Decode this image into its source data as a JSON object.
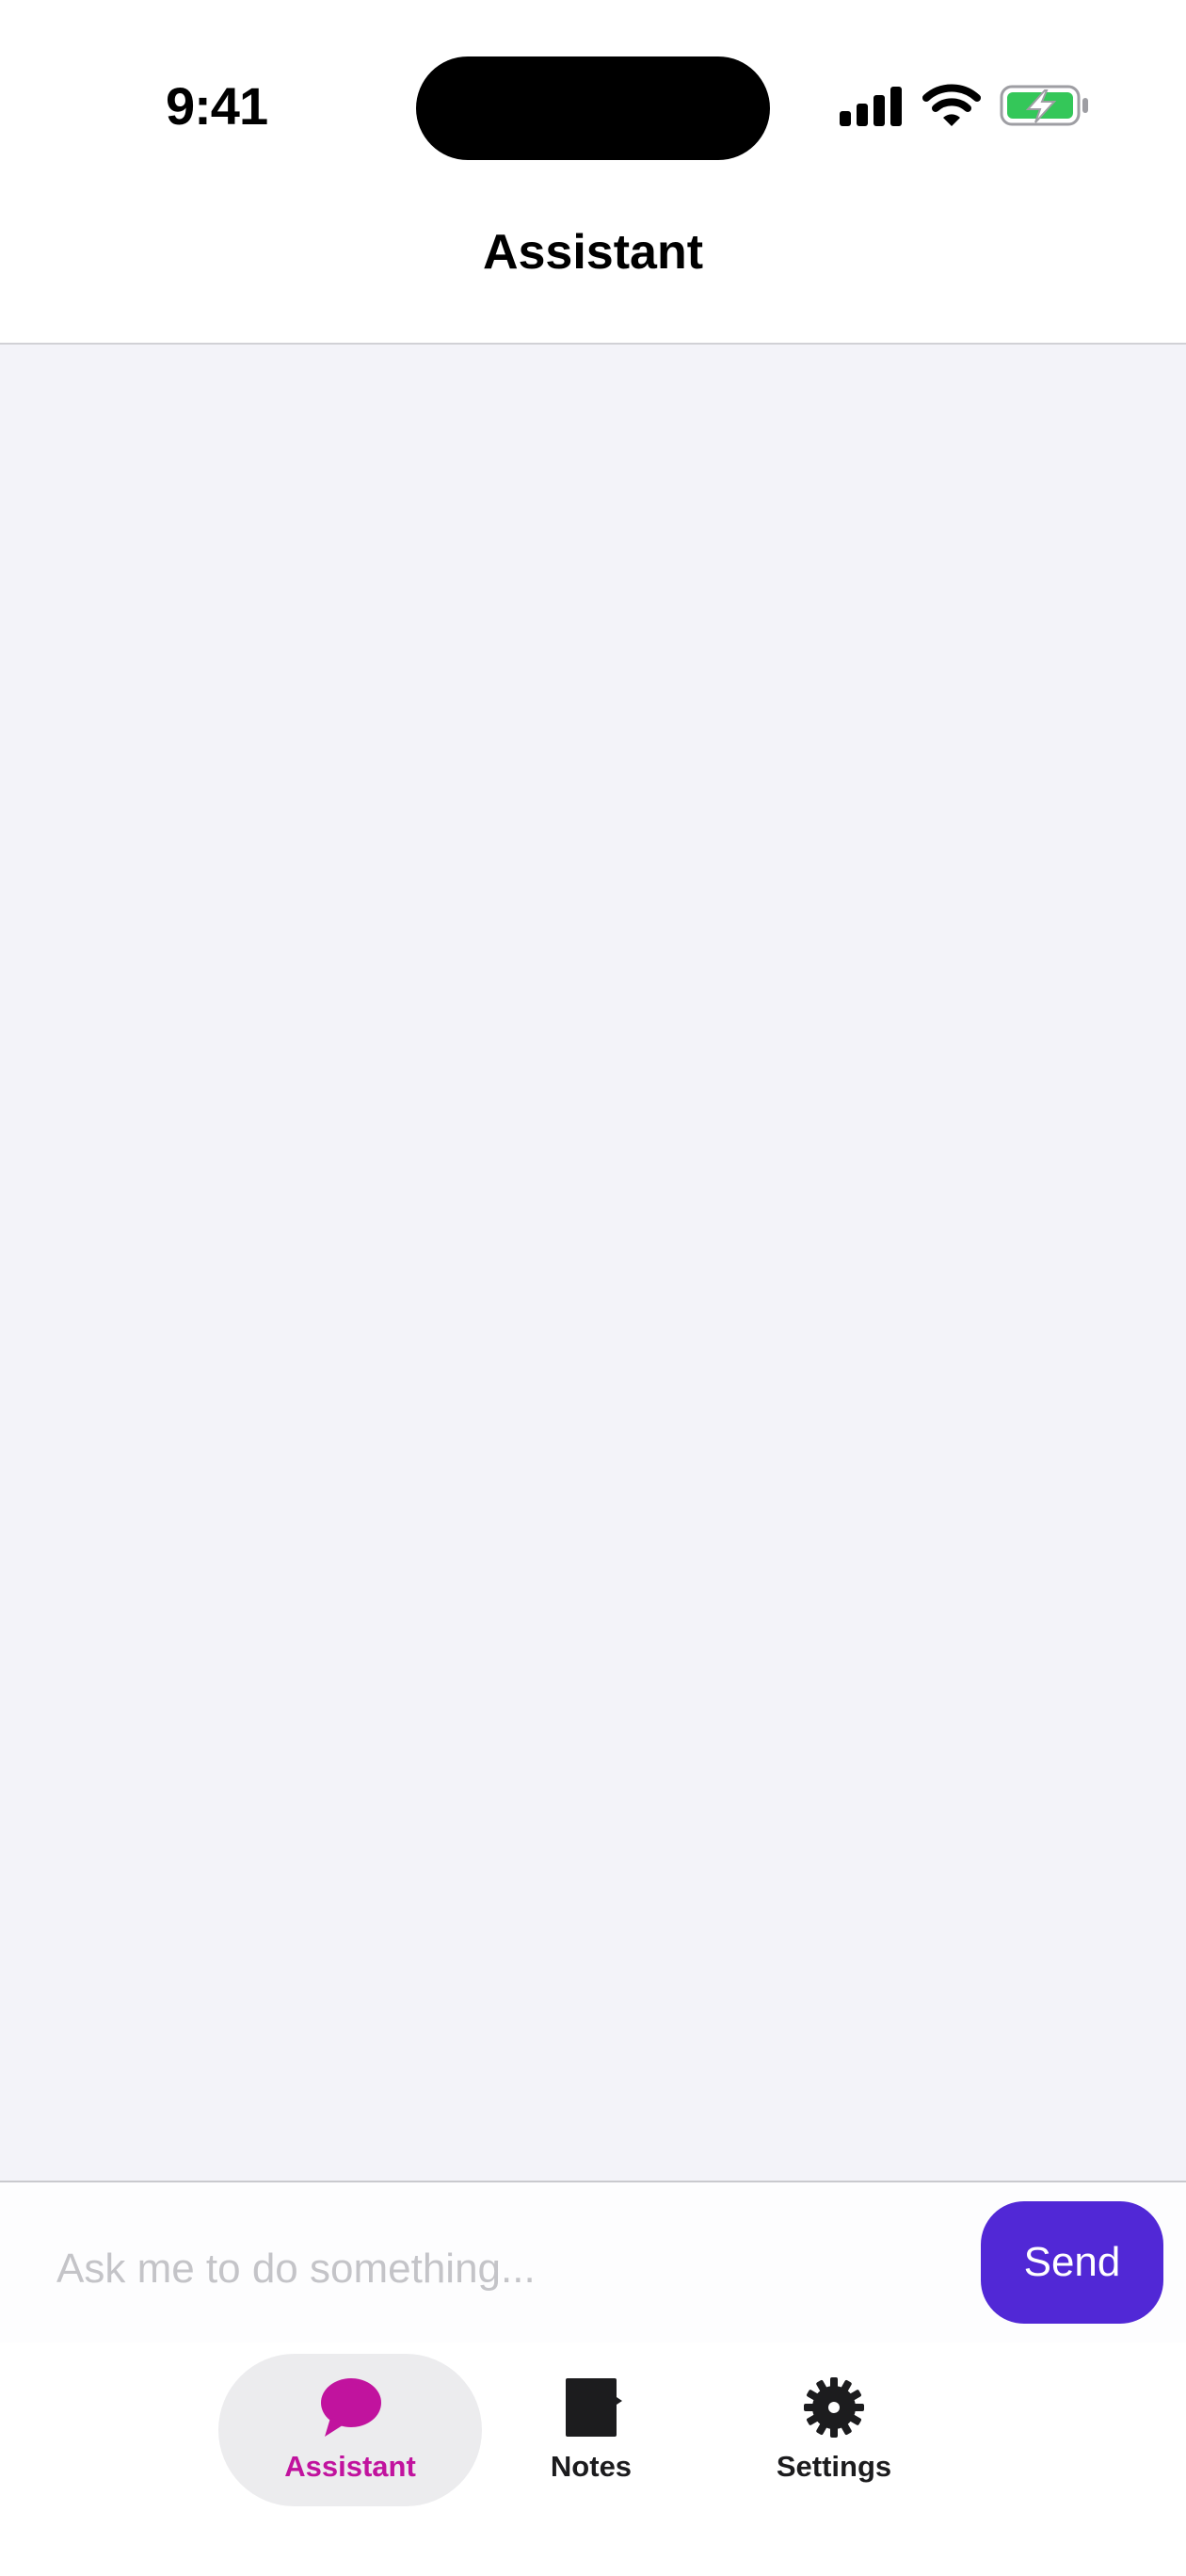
{
  "status_bar": {
    "time": "9:41"
  },
  "nav": {
    "title": "Assistant"
  },
  "composer": {
    "placeholder": "Ask me to do something...",
    "value": "",
    "send_label": "Send"
  },
  "tabs": [
    {
      "label": "Assistant",
      "icon": "chat-bubble-icon",
      "active": true
    },
    {
      "label": "Notes",
      "icon": "notes-icon",
      "active": false
    },
    {
      "label": "Settings",
      "icon": "gear-icon",
      "active": false
    }
  ],
  "colors": {
    "accent": "#c1139e",
    "send_button": "#5128d6",
    "chat_background": "#f3f3f9",
    "battery_fill": "#34c759"
  }
}
